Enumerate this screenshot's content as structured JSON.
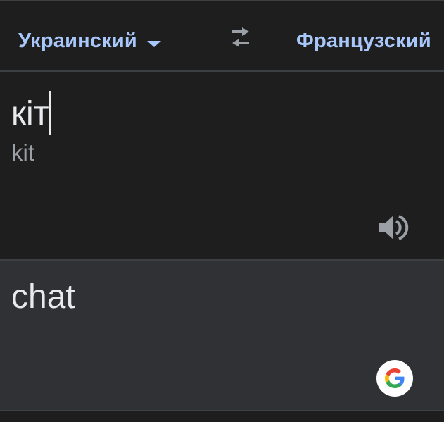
{
  "language_bar": {
    "source_language": "Украинский",
    "target_language": "Французский",
    "dropdown_icon": "caret-down-icon",
    "swap_icon": "swap-arrows-icon"
  },
  "source": {
    "text": "кіт",
    "transliteration": "kit",
    "speaker_icon": "volume-icon"
  },
  "result": {
    "text": "chat",
    "logo_icon": "google-g-icon"
  },
  "colors": {
    "background": "#202124",
    "panel": "#1e1e1f",
    "result_panel": "#303134",
    "accent": "#a8c7fa",
    "text": "#e8eaed",
    "muted_text": "#9aa0a6",
    "icon": "#9aa0a6"
  }
}
